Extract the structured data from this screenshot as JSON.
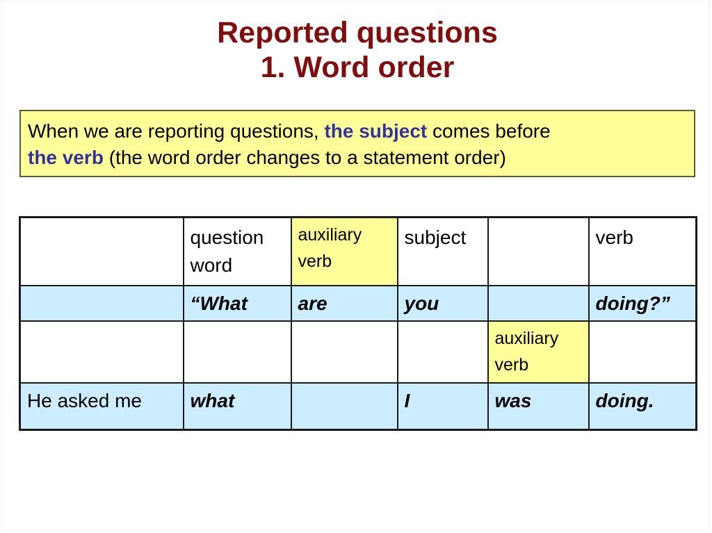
{
  "slide": {
    "title_line1": "Reported questions",
    "title_line2": "1. Word order",
    "colors": {
      "title": "#7f0f0f",
      "note_background": "#ffff99",
      "note_highlight": "#333399",
      "row_highlight": "#ccecff",
      "aux_highlight": "#ffff99",
      "example_text": "#0f3f0f"
    }
  },
  "note": {
    "part1": "When we are reporting questions, ",
    "highlight1": "the subject",
    "part2": " comes before ",
    "highlight2": "the verb",
    "part3": " (the word order changes to a statement order)"
  },
  "table": {
    "header_row": [
      "",
      "question word",
      "auxiliary verb",
      "subject",
      "",
      "verb"
    ],
    "direct_question_row": [
      "",
      "“What",
      "are",
      "you",
      "",
      "doing?”"
    ],
    "auxiliary_label_row": [
      "",
      "",
      "",
      "",
      "auxiliary verb",
      ""
    ],
    "reported_question_row": [
      "He asked me",
      "what",
      "",
      "I",
      "was",
      "doing."
    ]
  }
}
